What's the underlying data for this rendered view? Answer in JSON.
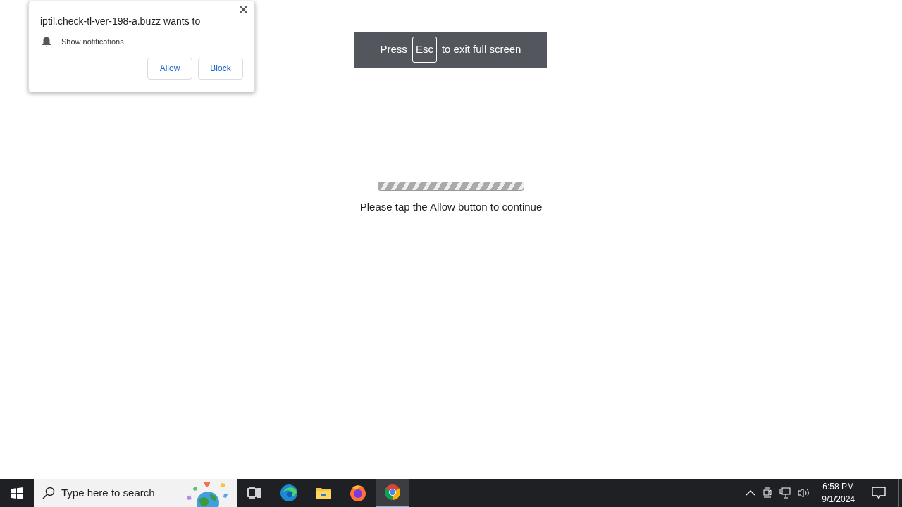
{
  "notification_prompt": {
    "title": "iptil.check-tl-ver-198-a.buzz wants to",
    "permission": "Show notifications",
    "buttons": [
      "Allow",
      "Block"
    ]
  },
  "fullscreen_toast": {
    "before": "Press",
    "key": "Esc",
    "after": "to exit full screen"
  },
  "page": {
    "progress": {
      "level": 1
    },
    "message": "Please tap the Allow button to continue"
  },
  "taskbar": {
    "search": {
      "placeholder": "Type here to search"
    },
    "apps": [
      {
        "kind": "taskview",
        "selected": false
      },
      {
        "kind": "edge",
        "selected": false
      },
      {
        "kind": "explorer",
        "selected": false
      },
      {
        "kind": "firefox",
        "selected": false
      },
      {
        "kind": "chrome",
        "selected": true
      }
    ],
    "clock": {
      "time": "6:58 PM",
      "date": "9/1/2024"
    }
  }
}
